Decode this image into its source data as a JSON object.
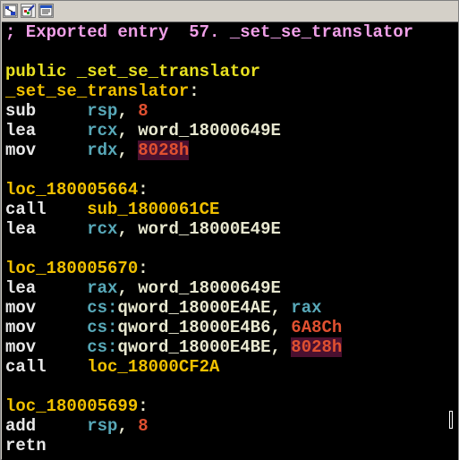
{
  "toolbar": {
    "buttons": [
      {
        "icon": "graph-view-icon"
      },
      {
        "icon": "edit-icon"
      },
      {
        "icon": "text-view-icon"
      }
    ]
  },
  "lines": [
    {
      "type": "comment",
      "text": "; Exported entry  57. _set_se_translator"
    },
    {
      "type": "blank"
    },
    {
      "type": "public",
      "kw": "public",
      "name": "_set_se_translator"
    },
    {
      "type": "proc",
      "name": "_set_se_translator",
      "suffix": ":"
    },
    {
      "type": "insn",
      "mnem": "sub",
      "ops": [
        {
          "t": "reg",
          "v": "rsp"
        },
        {
          "t": "sep",
          "v": ", "
        },
        {
          "t": "num",
          "v": "8"
        }
      ]
    },
    {
      "type": "insn",
      "mnem": "lea",
      "ops": [
        {
          "t": "reg",
          "v": "rcx"
        },
        {
          "t": "sep",
          "v": ", "
        },
        {
          "t": "sym",
          "v": "word_18000649E"
        }
      ]
    },
    {
      "type": "insn",
      "mnem": "mov",
      "ops": [
        {
          "t": "reg",
          "v": "rdx"
        },
        {
          "t": "sep",
          "v": ", "
        },
        {
          "t": "numhl",
          "v": "8028h"
        }
      ]
    },
    {
      "type": "blank"
    },
    {
      "type": "label",
      "name": "loc_180005664",
      "suffix": ":"
    },
    {
      "type": "insn",
      "mnem": "call",
      "ops": [
        {
          "t": "proc",
          "v": "sub_1800061CE"
        }
      ]
    },
    {
      "type": "insn",
      "mnem": "lea",
      "ops": [
        {
          "t": "reg",
          "v": "rcx"
        },
        {
          "t": "sep",
          "v": ", "
        },
        {
          "t": "sym",
          "v": "word_18000E49E"
        }
      ]
    },
    {
      "type": "blank"
    },
    {
      "type": "label",
      "name": "loc_180005670",
      "suffix": ":"
    },
    {
      "type": "insn",
      "mnem": "lea",
      "ops": [
        {
          "t": "reg",
          "v": "rax"
        },
        {
          "t": "sep",
          "v": ", "
        },
        {
          "t": "sym",
          "v": "word_18000649E"
        }
      ]
    },
    {
      "type": "insn",
      "mnem": "mov",
      "ops": [
        {
          "t": "cs",
          "v": "cs:"
        },
        {
          "t": "sym",
          "v": "qword_18000E4AE"
        },
        {
          "t": "sep",
          "v": ", "
        },
        {
          "t": "reg",
          "v": "rax"
        }
      ]
    },
    {
      "type": "insn",
      "mnem": "mov",
      "ops": [
        {
          "t": "cs",
          "v": "cs:"
        },
        {
          "t": "sym",
          "v": "qword_18000E4B6"
        },
        {
          "t": "sep",
          "v": ", "
        },
        {
          "t": "num",
          "v": "6A8Ch"
        }
      ]
    },
    {
      "type": "insn",
      "mnem": "mov",
      "ops": [
        {
          "t": "cs",
          "v": "cs:"
        },
        {
          "t": "sym",
          "v": "qword_18000E4BE"
        },
        {
          "t": "sep",
          "v": ", "
        },
        {
          "t": "numhl",
          "v": "8028h"
        }
      ]
    },
    {
      "type": "insn",
      "mnem": "call",
      "ops": [
        {
          "t": "proc",
          "v": "loc_18000CF2A"
        }
      ]
    },
    {
      "type": "blank"
    },
    {
      "type": "label",
      "name": "loc_180005699",
      "suffix": ":"
    },
    {
      "type": "insn",
      "mnem": "add",
      "ops": [
        {
          "t": "reg",
          "v": "rsp"
        },
        {
          "t": "sep",
          "v": ", "
        },
        {
          "t": "num",
          "v": "8"
        }
      ]
    },
    {
      "type": "insn",
      "mnem": "retn",
      "ops": []
    }
  ],
  "colors": {
    "background": "#000000",
    "comment": "#f0a0e8",
    "keyword": "#e8e020",
    "label": "#f0c000",
    "register": "#58a8b8",
    "number": "#e05030"
  }
}
